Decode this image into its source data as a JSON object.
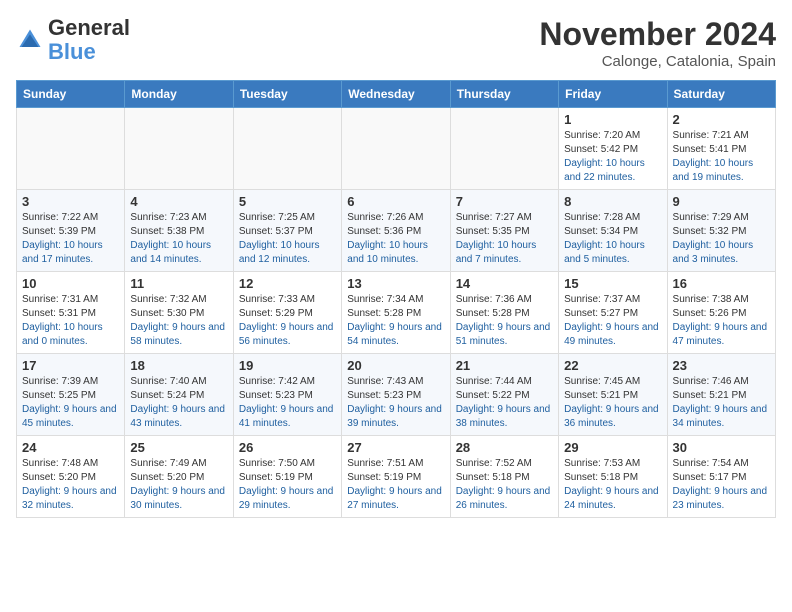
{
  "header": {
    "logo_general": "General",
    "logo_blue": "Blue",
    "month_title": "November 2024",
    "location": "Calonge, Catalonia, Spain"
  },
  "weekdays": [
    "Sunday",
    "Monday",
    "Tuesday",
    "Wednesday",
    "Thursday",
    "Friday",
    "Saturday"
  ],
  "weeks": [
    [
      {
        "day": "",
        "info": ""
      },
      {
        "day": "",
        "info": ""
      },
      {
        "day": "",
        "info": ""
      },
      {
        "day": "",
        "info": ""
      },
      {
        "day": "",
        "info": ""
      },
      {
        "day": "1",
        "info": "Sunrise: 7:20 AM\nSunset: 5:42 PM\nDaylight: 10 hours and 22 minutes."
      },
      {
        "day": "2",
        "info": "Sunrise: 7:21 AM\nSunset: 5:41 PM\nDaylight: 10 hours and 19 minutes."
      }
    ],
    [
      {
        "day": "3",
        "info": "Sunrise: 7:22 AM\nSunset: 5:39 PM\nDaylight: 10 hours and 17 minutes."
      },
      {
        "day": "4",
        "info": "Sunrise: 7:23 AM\nSunset: 5:38 PM\nDaylight: 10 hours and 14 minutes."
      },
      {
        "day": "5",
        "info": "Sunrise: 7:25 AM\nSunset: 5:37 PM\nDaylight: 10 hours and 12 minutes."
      },
      {
        "day": "6",
        "info": "Sunrise: 7:26 AM\nSunset: 5:36 PM\nDaylight: 10 hours and 10 minutes."
      },
      {
        "day": "7",
        "info": "Sunrise: 7:27 AM\nSunset: 5:35 PM\nDaylight: 10 hours and 7 minutes."
      },
      {
        "day": "8",
        "info": "Sunrise: 7:28 AM\nSunset: 5:34 PM\nDaylight: 10 hours and 5 minutes."
      },
      {
        "day": "9",
        "info": "Sunrise: 7:29 AM\nSunset: 5:32 PM\nDaylight: 10 hours and 3 minutes."
      }
    ],
    [
      {
        "day": "10",
        "info": "Sunrise: 7:31 AM\nSunset: 5:31 PM\nDaylight: 10 hours and 0 minutes."
      },
      {
        "day": "11",
        "info": "Sunrise: 7:32 AM\nSunset: 5:30 PM\nDaylight: 9 hours and 58 minutes."
      },
      {
        "day": "12",
        "info": "Sunrise: 7:33 AM\nSunset: 5:29 PM\nDaylight: 9 hours and 56 minutes."
      },
      {
        "day": "13",
        "info": "Sunrise: 7:34 AM\nSunset: 5:28 PM\nDaylight: 9 hours and 54 minutes."
      },
      {
        "day": "14",
        "info": "Sunrise: 7:36 AM\nSunset: 5:28 PM\nDaylight: 9 hours and 51 minutes."
      },
      {
        "day": "15",
        "info": "Sunrise: 7:37 AM\nSunset: 5:27 PM\nDaylight: 9 hours and 49 minutes."
      },
      {
        "day": "16",
        "info": "Sunrise: 7:38 AM\nSunset: 5:26 PM\nDaylight: 9 hours and 47 minutes."
      }
    ],
    [
      {
        "day": "17",
        "info": "Sunrise: 7:39 AM\nSunset: 5:25 PM\nDaylight: 9 hours and 45 minutes."
      },
      {
        "day": "18",
        "info": "Sunrise: 7:40 AM\nSunset: 5:24 PM\nDaylight: 9 hours and 43 minutes."
      },
      {
        "day": "19",
        "info": "Sunrise: 7:42 AM\nSunset: 5:23 PM\nDaylight: 9 hours and 41 minutes."
      },
      {
        "day": "20",
        "info": "Sunrise: 7:43 AM\nSunset: 5:23 PM\nDaylight: 9 hours and 39 minutes."
      },
      {
        "day": "21",
        "info": "Sunrise: 7:44 AM\nSunset: 5:22 PM\nDaylight: 9 hours and 38 minutes."
      },
      {
        "day": "22",
        "info": "Sunrise: 7:45 AM\nSunset: 5:21 PM\nDaylight: 9 hours and 36 minutes."
      },
      {
        "day": "23",
        "info": "Sunrise: 7:46 AM\nSunset: 5:21 PM\nDaylight: 9 hours and 34 minutes."
      }
    ],
    [
      {
        "day": "24",
        "info": "Sunrise: 7:48 AM\nSunset: 5:20 PM\nDaylight: 9 hours and 32 minutes."
      },
      {
        "day": "25",
        "info": "Sunrise: 7:49 AM\nSunset: 5:20 PM\nDaylight: 9 hours and 30 minutes."
      },
      {
        "day": "26",
        "info": "Sunrise: 7:50 AM\nSunset: 5:19 PM\nDaylight: 9 hours and 29 minutes."
      },
      {
        "day": "27",
        "info": "Sunrise: 7:51 AM\nSunset: 5:19 PM\nDaylight: 9 hours and 27 minutes."
      },
      {
        "day": "28",
        "info": "Sunrise: 7:52 AM\nSunset: 5:18 PM\nDaylight: 9 hours and 26 minutes."
      },
      {
        "day": "29",
        "info": "Sunrise: 7:53 AM\nSunset: 5:18 PM\nDaylight: 9 hours and 24 minutes."
      },
      {
        "day": "30",
        "info": "Sunrise: 7:54 AM\nSunset: 5:17 PM\nDaylight: 9 hours and 23 minutes."
      }
    ]
  ]
}
